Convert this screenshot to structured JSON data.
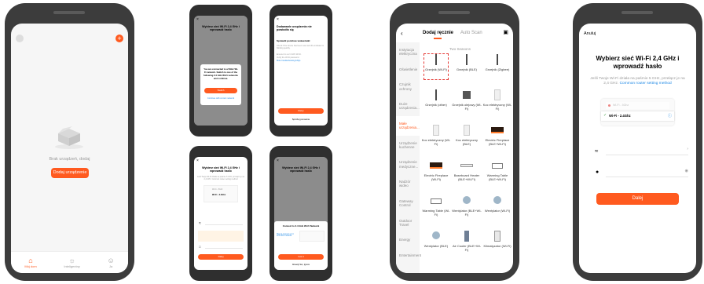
{
  "screen1": {
    "empty_text": "Brak urządzeń, dodaj",
    "add_button": "Dodaj urządzenie",
    "tabs": [
      {
        "label": "Mój dom",
        "icon": "home-icon"
      },
      {
        "label": "Inteligentny",
        "icon": "sun-icon"
      },
      {
        "label": "Ja",
        "icon": "profile-icon"
      }
    ]
  },
  "screen2a": {
    "title": "Wybierz sieć Wi-Fi 2,4 GHz i wprowadź hasło",
    "dialog_text": "You are connected to a 5GHz Wi-Fi network. Switch to one of the following 2.4 GHz Wi-Fi networks and continue.",
    "dialog_button": "Switch",
    "dialog_link": "Continue with current network"
  },
  "screen2b": {
    "title": "Dodawanie urządzenia nie powiodło się",
    "subtitle": "Sprawdź poniższe wskazówki:",
    "tip_lines": [
      "Check if the device has been reset and the indicator is blinking quickly.",
      "Ensure it is a 2.4 GHz Wi-Fi.",
      "Verify the Wi-Fi password.",
      "More troubleshooting FAQs"
    ],
    "retry_button": "Retry",
    "back_link": "Spróbuj ponownie"
  },
  "screen2c": {
    "title": "Wybierz sieć Wi-Fi 2,4 GHz i wprowadź hasło",
    "subtitle": "Jeśli Twoje Wi-Fi działa na paśmie 5 GHz, przełącz je na 2,4 GHz. Common router setting method",
    "wifi_5g": "Wi-Fi - 5Ghz",
    "wifi_24g": "Wi-Fi - 2.4Ghz",
    "next_button": "Dalej"
  },
  "screen2d": {
    "title": "Wybierz sieć Wi-Fi 2,4 GHz i wprowadź hasło",
    "dialog_title": "Connect to 2.4 GHz Wi-Fi Network",
    "dialog_link": "How to connect a 2.4 GHz Wi-Fi network",
    "dialog_button": "Got it",
    "dialog_secondary": "Already Set, Ignore"
  },
  "screen3": {
    "tab_manual": "Dodaj ręcznie",
    "tab_auto": "Auto Scan",
    "section_title": "Two Seasons",
    "sidebar": [
      "Instytucja elektryczna",
      "Oświetlenie",
      "Czujnik ochrony",
      "Duże urządzenia...",
      "Małe urządzenia...",
      "Urządzenie kuchenne",
      "Urządzenie medyczne...",
      "Nadzór wideo",
      "Gateway Control",
      "Outdoor Travel",
      "Energy",
      "Entertainment"
    ],
    "devices": [
      "Grzejnik (Wi-Fi)",
      "Grzejnik (BLE)",
      "Grzejnik (Zigbee)",
      "Grzejnik (other)",
      "Grzejnik olejowy (Wi-Fi)",
      "Koc elektryczny (Wi-Fi)",
      "Koc elektryczny (Wi-Fi)",
      "Koc elektryczny (BLE)",
      "Electric Fireplace (BLE+Wi-Fi)",
      "Electric Fireplace (Wi-Fi)",
      "Baseboard Heater (BLE+Wi-Fi)",
      "Warming Table (BLE+Wi-Fi)",
      "Warming Table (Wi-Fi)",
      "Wentylator (BLE+Wi-Fi)",
      "Wentylator (Wi-Fi)",
      "Wentylator (BLE)",
      "Air Cooler (BLE+Wi-Fi)",
      "Klimatyzator (Wi-Fi)"
    ]
  },
  "screen4": {
    "cancel": "Anuluj",
    "title": "Wybierz sieć Wi-Fi 2,4 GHz i wprowadź hasło",
    "subtitle": "Jeśli Twoje Wi-Fi działa na paśmie 5 GHz, przełącz je na 2,4 GHz.",
    "subtitle_link": "Common router setting method",
    "wifi_5g": "Wi-Fi - 5Ghz",
    "wifi_24g": "Wi-Fi - 2.4Ghz",
    "wifi_field_value": "",
    "password_value": "",
    "next_button": "Dalej"
  },
  "colors": {
    "accent": "#ff5a1f",
    "link": "#1e88e5",
    "phone": "#3c3c3c"
  }
}
